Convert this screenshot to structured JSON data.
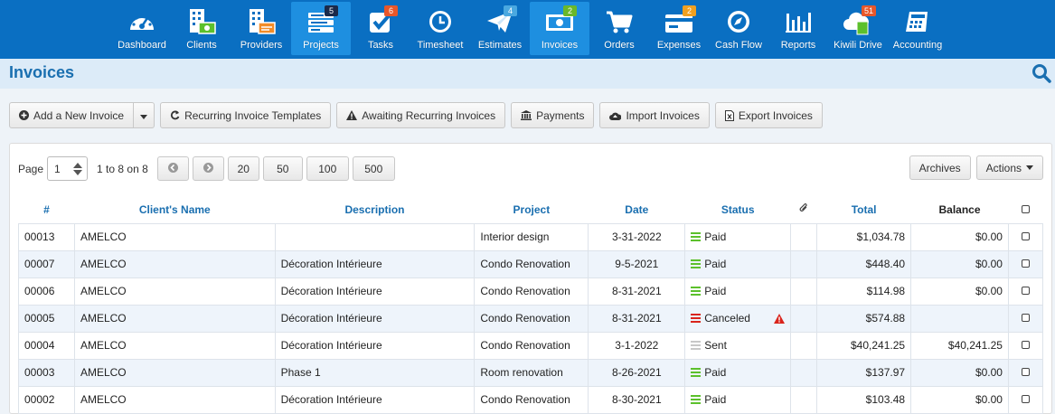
{
  "nav": {
    "items": [
      {
        "label": "Dashboard",
        "icon": "dashboard-icon",
        "badge": ""
      },
      {
        "label": "Clients",
        "icon": "clients-icon",
        "badge": ""
      },
      {
        "label": "Providers",
        "icon": "providers-icon",
        "badge": ""
      },
      {
        "label": "Projects",
        "icon": "projects-icon",
        "badge": "5"
      },
      {
        "label": "Tasks",
        "icon": "tasks-icon",
        "badge": "6"
      },
      {
        "label": "Timesheet",
        "icon": "timesheet-icon",
        "badge": ""
      },
      {
        "label": "Estimates",
        "icon": "estimates-icon",
        "badge": "4"
      },
      {
        "label": "Invoices",
        "icon": "invoices-icon",
        "badge": "2"
      },
      {
        "label": "Orders",
        "icon": "orders-icon",
        "badge": ""
      },
      {
        "label": "Expenses",
        "icon": "expenses-icon",
        "badge": "2"
      },
      {
        "label": "Cash Flow",
        "icon": "cashflow-icon",
        "badge": ""
      },
      {
        "label": "Reports",
        "icon": "reports-icon",
        "badge": ""
      },
      {
        "label": "Kiwili Drive",
        "icon": "drive-icon",
        "badge": "51"
      },
      {
        "label": "Accounting",
        "icon": "accounting-icon",
        "badge": ""
      }
    ],
    "active": "Invoices"
  },
  "page": {
    "title": "Invoices"
  },
  "toolbar": {
    "add_label": "Add a New Invoice",
    "recurring_label": "Recurring Invoice Templates",
    "awaiting_label": "Awaiting Recurring Invoices",
    "payments_label": "Payments",
    "import_label": "Import Invoices",
    "export_label": "Export Invoices"
  },
  "pager": {
    "page_label": "Page",
    "page_value": "1",
    "range_text": "1 to 8 on 8",
    "sizes": [
      "20",
      "50",
      "100",
      "500"
    ],
    "archives_label": "Archives",
    "actions_label": "Actions"
  },
  "table": {
    "headers": {
      "number": "#",
      "client": "Client's Name",
      "description": "Description",
      "project": "Project",
      "date": "Date",
      "status": "Status",
      "total": "Total",
      "balance": "Balance"
    },
    "rows": [
      {
        "number": "00013",
        "client": "AMELCO",
        "description": "",
        "project": "Interior design",
        "date": "3-31-2022",
        "status": "Paid",
        "total": "$1,034.78",
        "balance": "$0.00",
        "warning": false
      },
      {
        "number": "00007",
        "client": "AMELCO",
        "description": "Décoration Intérieure",
        "project": "Condo Renovation",
        "date": "9-5-2021",
        "status": "Paid",
        "total": "$448.40",
        "balance": "$0.00",
        "warning": false
      },
      {
        "number": "00006",
        "client": "AMELCO",
        "description": "Décoration Intérieure",
        "project": "Condo Renovation",
        "date": "8-31-2021",
        "status": "Paid",
        "total": "$114.98",
        "balance": "$0.00",
        "warning": false
      },
      {
        "number": "00005",
        "client": "AMELCO",
        "description": "Décoration Intérieure",
        "project": "Condo Renovation",
        "date": "8-31-2021",
        "status": "Canceled",
        "total": "$574.88",
        "balance": "",
        "warning": true
      },
      {
        "number": "00004",
        "client": "AMELCO",
        "description": "Décoration Intérieure",
        "project": "Condo Renovation",
        "date": "3-1-2022",
        "status": "Sent",
        "total": "$40,241.25",
        "balance": "$40,241.25",
        "warning": false
      },
      {
        "number": "00003",
        "client": "AMELCO",
        "description": "Phase 1",
        "project": "Room renovation",
        "date": "8-26-2021",
        "status": "Paid",
        "total": "$137.97",
        "balance": "$0.00",
        "warning": false
      },
      {
        "number": "00002",
        "client": "AMELCO",
        "description": "Décoration Intérieure",
        "project": "Condo Renovation",
        "date": "8-30-2021",
        "status": "Paid",
        "total": "$103.48",
        "balance": "$0.00",
        "warning": false
      }
    ]
  },
  "colors": {
    "topbar": "#0a6fc2",
    "active_nav": "#1e8fe0",
    "paid": "#5cc02c",
    "canceled": "#d9241c",
    "sent": "#c8c8c8",
    "title": "#1a6fb0"
  }
}
